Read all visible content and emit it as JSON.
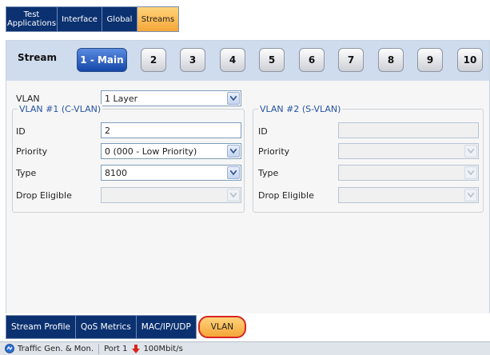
{
  "top_tabs": [
    {
      "label": "Test Applications",
      "active": false
    },
    {
      "label": "Interface",
      "active": false
    },
    {
      "label": "Global",
      "active": false
    },
    {
      "label": "Streams",
      "active": true
    }
  ],
  "stream_bar": {
    "label": "Stream",
    "buttons": [
      "1 - Main",
      "2",
      "3",
      "4",
      "5",
      "6",
      "7",
      "8",
      "9",
      "10"
    ],
    "active_index": 0
  },
  "vlan": {
    "label": "VLAN",
    "value": "1 Layer"
  },
  "vlan1": {
    "title": "VLAN #1 (C-VLAN)",
    "id_label": "ID",
    "id_value": "2",
    "priority_label": "Priority",
    "priority_value": "0 (000 - Low Priority)",
    "type_label": "Type",
    "type_value": "8100",
    "drop_label": "Drop Eligible",
    "drop_value": ""
  },
  "vlan2": {
    "title": "VLAN #2 (S-VLAN)",
    "id_label": "ID",
    "id_value": "",
    "priority_label": "Priority",
    "priority_value": "",
    "type_label": "Type",
    "type_value": "",
    "drop_label": "Drop Eligible",
    "drop_value": ""
  },
  "bottom_tabs": [
    {
      "label": "Stream Profile",
      "active": false
    },
    {
      "label": "QoS Metrics",
      "active": false
    },
    {
      "label": "MAC/IP/UDP",
      "active": false
    },
    {
      "label": "VLAN",
      "active": true
    }
  ],
  "status": {
    "app": "Traffic Gen. & Mon.",
    "port": "Port 1",
    "rate": "100Mbit/s"
  },
  "colors": {
    "tab_bg": "#0b3170",
    "active_tab": "#f4a638",
    "highlight_ring": "#d92424",
    "stream_active": "#1447a8"
  }
}
